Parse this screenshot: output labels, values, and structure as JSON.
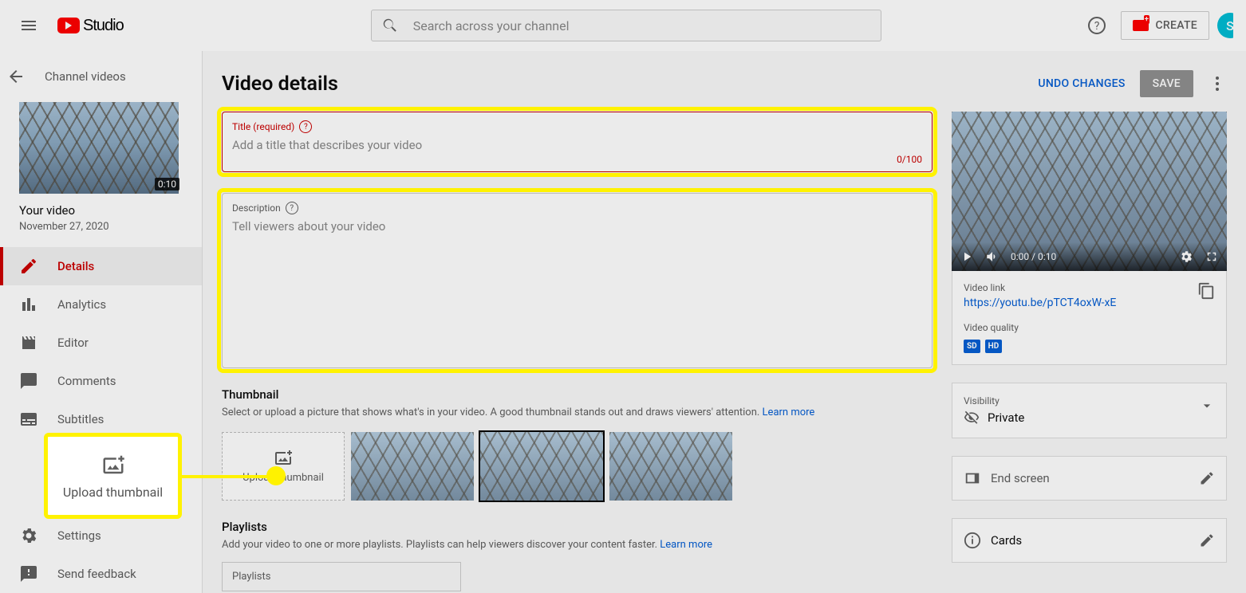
{
  "header": {
    "logo_text": "Studio",
    "search_placeholder": "Search across your channel",
    "create_label": "CREATE",
    "avatar_letter": "S"
  },
  "sidebar": {
    "back_label": "Channel videos",
    "thumb_duration": "0:10",
    "video_title": "Your video",
    "video_date": "November 27, 2020",
    "items": [
      {
        "label": "Details"
      },
      {
        "label": "Analytics"
      },
      {
        "label": "Editor"
      },
      {
        "label": "Comments"
      },
      {
        "label": "Subtitles"
      }
    ],
    "settings_label": "Settings",
    "feedback_label": "Send feedback"
  },
  "page": {
    "title": "Video details",
    "undo_label": "UNDO CHANGES",
    "save_label": "SAVE"
  },
  "title_field": {
    "label": "Title (required)",
    "placeholder": "Add a title that describes your video",
    "counter": "0/100"
  },
  "description_field": {
    "label": "Description",
    "placeholder": "Tell viewers about your video"
  },
  "thumbnail": {
    "heading": "Thumbnail",
    "text": "Select or upload a picture that shows what's in your video. A good thumbnail stands out and draws viewers' attention.",
    "learn": "Learn more",
    "upload_label": "Upload thumbnail"
  },
  "playlists": {
    "heading": "Playlists",
    "text": "Add your video to one or more playlists. Playlists can help viewers discover your content faster. ",
    "learn": "Learn more",
    "select_label": "Playlists"
  },
  "player": {
    "time": "0:00 / 0:10"
  },
  "video_info": {
    "link_label": "Video link",
    "link": "https://youtu.be/pTCT4oxW-xE",
    "quality_label": "Video quality",
    "badge_sd": "SD",
    "badge_hd": "HD"
  },
  "visibility": {
    "label": "Visibility",
    "value": "Private"
  },
  "rows": {
    "end_screen": "End screen",
    "cards": "Cards"
  },
  "callout": {
    "label": "Upload thumbnail"
  }
}
